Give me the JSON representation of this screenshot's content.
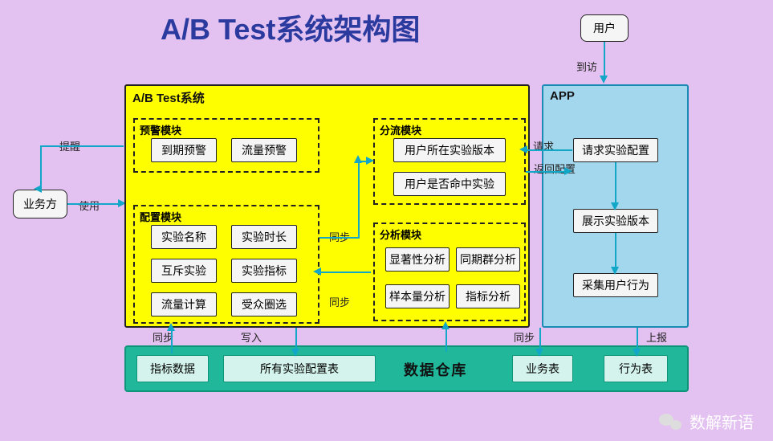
{
  "title": "A/B Test系统架构图",
  "user_box": "用户",
  "biz_box": "业务方",
  "edges": {
    "visit": "到访",
    "remind": "提醒",
    "use": "使用",
    "request": "请求",
    "return_config": "返回配置",
    "sync": "同步",
    "write": "写入",
    "report": "上报"
  },
  "abtest": {
    "label": "A/B Test系统",
    "alert_module": {
      "label": "预警模块",
      "items": [
        "到期预警",
        "流量预警"
      ]
    },
    "config_module": {
      "label": "配置模块",
      "items": [
        "实验名称",
        "实验时长",
        "互斥实验",
        "实验指标",
        "流量计算",
        "受众圈选"
      ]
    },
    "diversion_module": {
      "label": "分流模块",
      "items": [
        "用户所在实验版本",
        "用户是否命中实验"
      ]
    },
    "analysis_module": {
      "label": "分析模块",
      "items": [
        "显著性分析",
        "同期群分析",
        "样本量分析",
        "指标分析"
      ]
    }
  },
  "app": {
    "label": "APP",
    "items": [
      "请求实验配置",
      "展示实验版本",
      "采集用户行为"
    ]
  },
  "datawarehouse": {
    "label": "数据仓库",
    "items": [
      "指标数据",
      "所有实验配置表",
      "业务表",
      "行为表"
    ]
  },
  "footer": "数解新语"
}
